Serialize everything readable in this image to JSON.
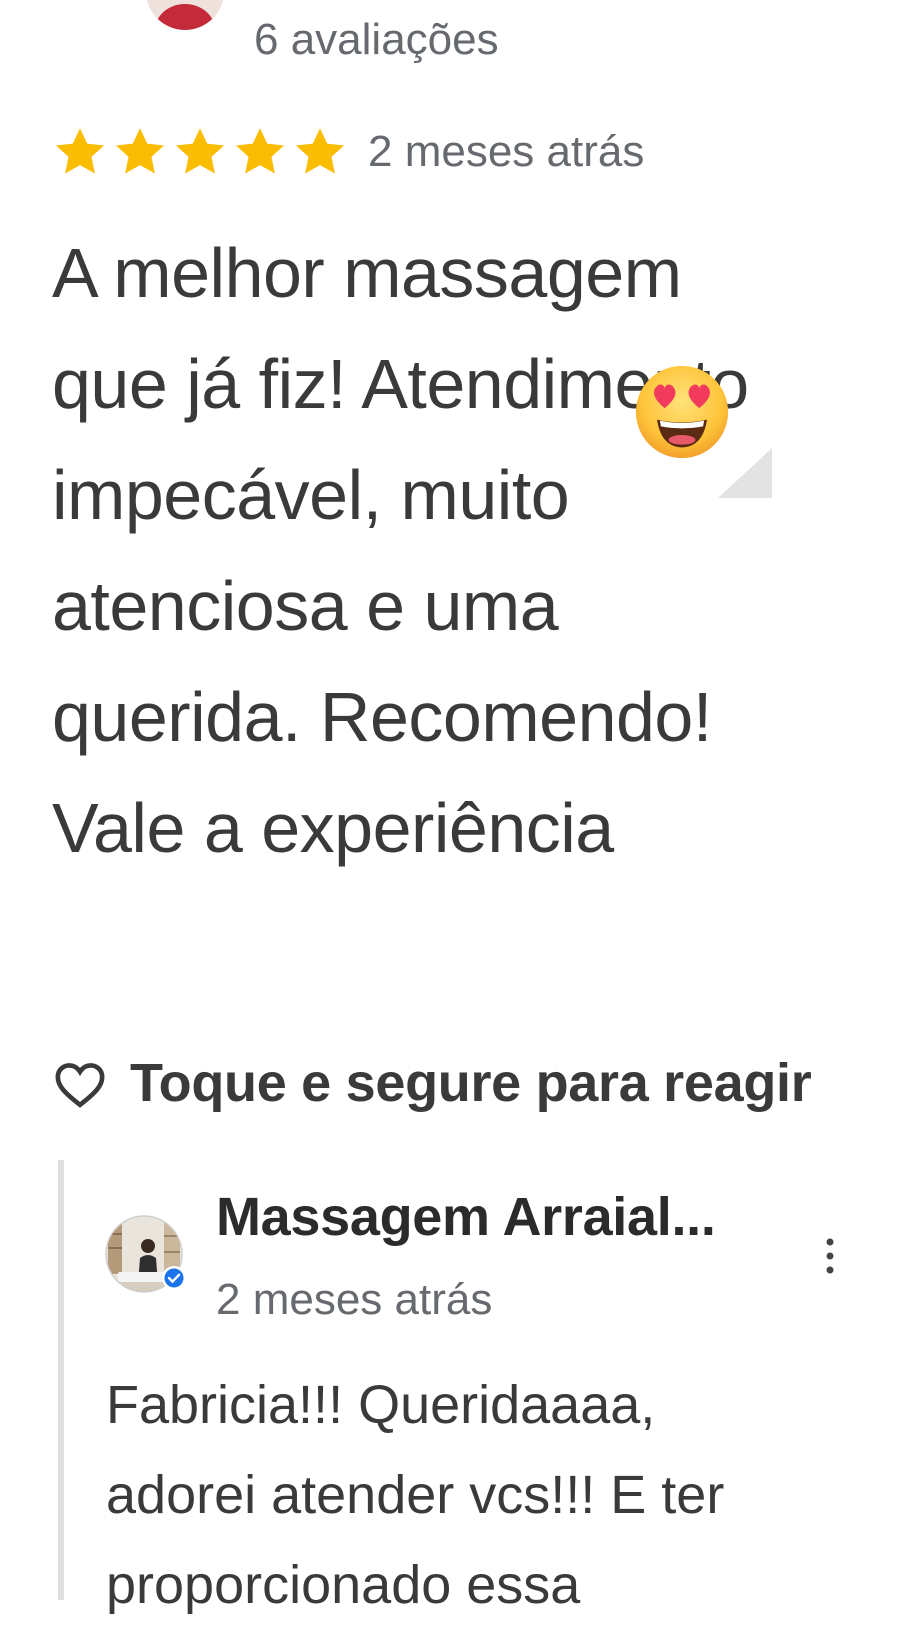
{
  "review": {
    "reviewer_count_text": "6 avaliações",
    "rating": 5,
    "rating_max": 5,
    "date": "2 meses atrás",
    "text": "A melhor massagem que já fiz! Atendimento impecável, muito atenciosa e uma querida. Recomendo! Vale a experiência",
    "emoji": "smiling-face-with-heart-eyes",
    "star_color": "#FBBC04"
  },
  "reaction": {
    "label": "Toque e segure para reagir",
    "icon": "heart-outline-icon"
  },
  "owner_reply": {
    "name": "Massagem Arraial...",
    "date": "2 meses atrás",
    "verified": true,
    "verified_color": "#1A73E8",
    "text": "Fabricia!!! Queridaaaa, adorei atender vcs!!! E ter proporcionado essa"
  }
}
